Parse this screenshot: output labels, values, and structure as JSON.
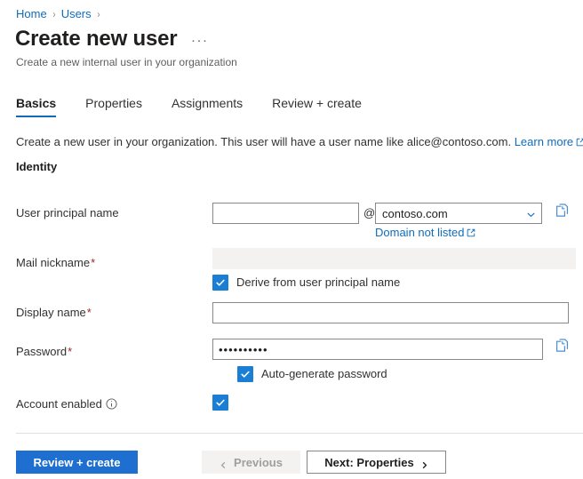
{
  "breadcrumb": {
    "items": [
      {
        "label": "Home"
      },
      {
        "label": "Users"
      }
    ],
    "separator": "›"
  },
  "header": {
    "title": "Create new user",
    "overflow_label": "···",
    "subtitle": "Create a new internal user in your organization"
  },
  "tabs": [
    {
      "label": "Basics",
      "active": true
    },
    {
      "label": "Properties",
      "active": false
    },
    {
      "label": "Assignments",
      "active": false
    },
    {
      "label": "Review + create",
      "active": false
    }
  ],
  "intro": {
    "text": "Create a new user in your organization. This user will have a user name like alice@contoso.com.",
    "link_label": "Learn more",
    "link_icon": "external-link-icon"
  },
  "section": {
    "heading": "Identity"
  },
  "form": {
    "user_principal_name": {
      "label": "User principal name",
      "value": "",
      "placeholder": "",
      "at_symbol": "@",
      "domain_value": "contoso.com",
      "domain_options": [
        "contoso.com"
      ],
      "domain_not_listed_label": "Domain not listed",
      "copy_icon": "copy-icon"
    },
    "mail_nickname": {
      "label": "Mail nickname",
      "required_marker": "*",
      "value": "",
      "disabled": true,
      "checkbox_label": "Derive from user principal name",
      "checkbox_checked": true
    },
    "display_name": {
      "label": "Display name",
      "required_marker": "*",
      "value": "",
      "placeholder": ""
    },
    "password": {
      "label": "Password",
      "required_marker": "*",
      "value": "••••••••••",
      "copy_icon": "copy-icon",
      "checkbox_label": "Auto-generate password",
      "checkbox_checked": true
    },
    "account_enabled": {
      "label": "Account enabled",
      "info_icon": "info-icon",
      "checked": true
    }
  },
  "footer": {
    "review_create_label": "Review + create",
    "previous_label": "Previous",
    "next_label": "Next: Properties"
  },
  "colors": {
    "accent": "#0f6cbd",
    "primary_button": "#1f6fd0",
    "checkbox": "#1a7fd4",
    "required_star": "#a4262c",
    "disabled_field": "#f3f2f1",
    "border": "#8a8886",
    "divider": "#e1dfdd"
  }
}
